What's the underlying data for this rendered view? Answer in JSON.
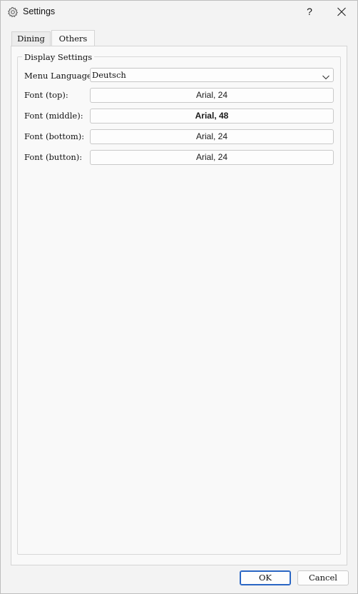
{
  "window": {
    "title": "Settings",
    "help_label": "?",
    "icons": {
      "app": "gear-icon",
      "close": "close-icon"
    }
  },
  "tabs": [
    {
      "label": "Dining",
      "selected": false
    },
    {
      "label": "Others",
      "selected": true
    }
  ],
  "display_settings": {
    "group_title": "Display Settings",
    "menu_language": {
      "label": "Menu Language:",
      "value": "Deutsch"
    },
    "fonts": [
      {
        "label": "Font (top):",
        "value": "Arial, 24",
        "bold": false
      },
      {
        "label": "Font (middle):",
        "value": "Arial, 48",
        "bold": true
      },
      {
        "label": "Font (bottom):",
        "value": "Arial, 24",
        "bold": false
      },
      {
        "label": "Font (button):",
        "value": "Arial, 24",
        "bold": false
      }
    ]
  },
  "buttons": {
    "ok": "OK",
    "cancel": "Cancel"
  },
  "colors": {
    "accent": "#2a66c4",
    "background": "#f3f3f3",
    "pane": "#f9f9f9"
  }
}
